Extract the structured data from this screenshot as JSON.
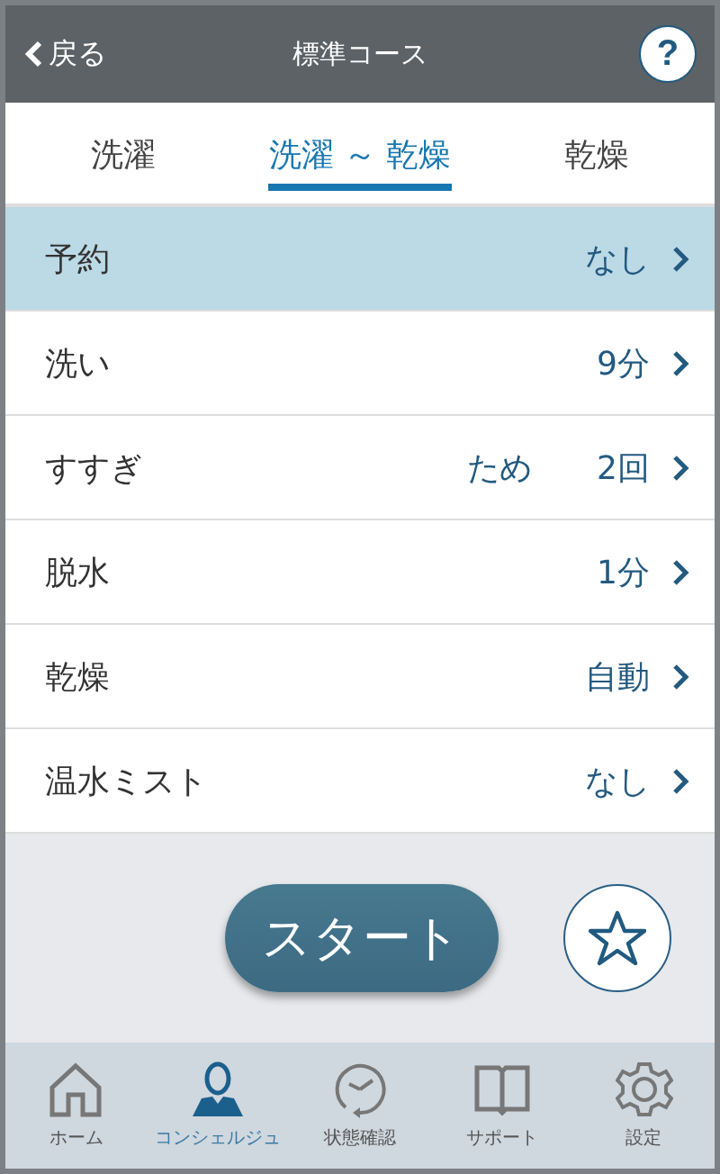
{
  "header": {
    "back": "戻る",
    "title": "標準コース",
    "help": "?"
  },
  "tabs": [
    {
      "label": "洗濯",
      "selected": false
    },
    {
      "label": "洗濯 ～ 乾燥",
      "selected": true
    },
    {
      "label": "乾燥",
      "selected": false
    }
  ],
  "settings": [
    {
      "label": "予約",
      "values": [
        "なし"
      ],
      "selected": true
    },
    {
      "label": "洗い",
      "values": [
        "9分"
      ],
      "selected": false
    },
    {
      "label": "すすぎ",
      "values": [
        "ため",
        "2回"
      ],
      "selected": false
    },
    {
      "label": "脱水",
      "values": [
        "1分"
      ],
      "selected": false
    },
    {
      "label": "乾燥",
      "values": [
        "自動"
      ],
      "selected": false
    },
    {
      "label": "温水ミスト",
      "values": [
        "なし"
      ],
      "selected": false
    }
  ],
  "start_button": "スタート",
  "nav": [
    {
      "kind": "home",
      "label": "ホーム",
      "selected": false
    },
    {
      "kind": "concierge",
      "label": "コンシェルジュ",
      "selected": true
    },
    {
      "kind": "status",
      "label": "状態確認",
      "selected": false
    },
    {
      "kind": "support",
      "label": "サポート",
      "selected": false
    },
    {
      "kind": "settings",
      "label": "設定",
      "selected": false
    }
  ]
}
